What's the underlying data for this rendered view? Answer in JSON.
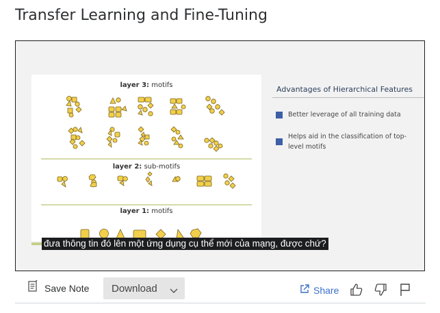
{
  "lecture": {
    "title": "Transfer Learning and Fine-Tuning"
  },
  "slide": {
    "figure": {
      "layer3_prefix": "layer 3:",
      "layer3_suffix": "motifs",
      "layer2_prefix": "layer 2:",
      "layer2_suffix": "sub-motifs",
      "layer1_prefix": "layer 1:",
      "layer1_suffix": "motifs"
    },
    "advantages": {
      "title": "Advantages of Hierarchical Features",
      "items": [
        "Better leverage of all training data",
        "Helps aid in the classification of top-level motifs"
      ]
    },
    "colors": {
      "shape_fill": "#f2cf4a",
      "shape_stroke": "#7a6420",
      "layer_rule": "#c5cf8a",
      "bullet": "#3c5fa6"
    }
  },
  "subtitle": {
    "text": "đưa thông tin đó lên một ứng dụng cụ thể mới của mạng, được chứ?"
  },
  "toolbar": {
    "save_note_label": "Save Note",
    "download_label": "Download",
    "share_label": "Share",
    "icons": [
      "note-icon",
      "chevron-down-icon",
      "share-icon",
      "thumbs-up-icon",
      "thumbs-down-icon",
      "flag-icon"
    ]
  }
}
